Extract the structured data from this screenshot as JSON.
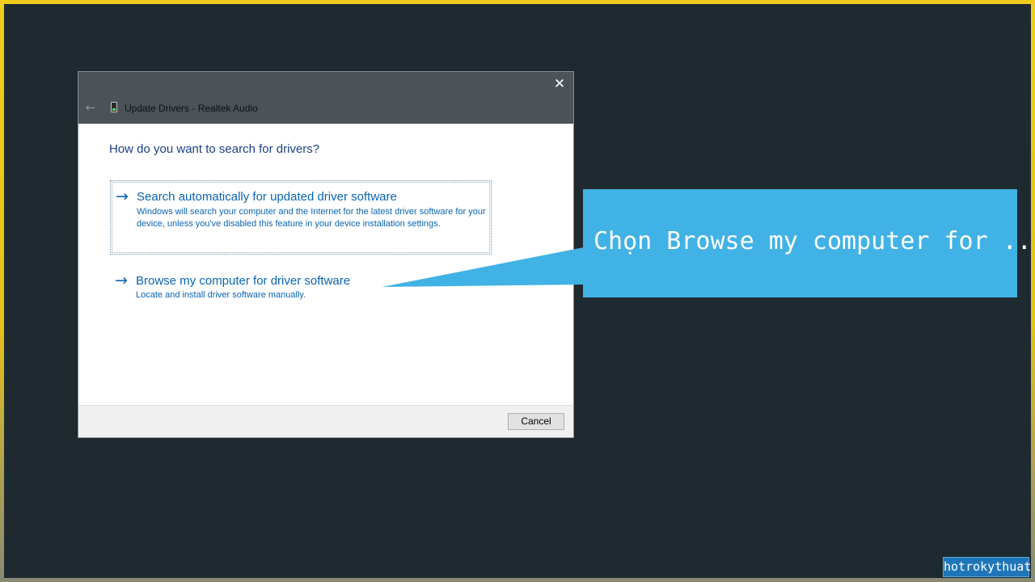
{
  "dialog": {
    "title": "Update Drivers - Realtek Audio",
    "close_icon": "close-icon",
    "back_icon": "back-arrow-icon",
    "device_icon": "audio-device-icon",
    "heading": "How do you want to search for drivers?",
    "options": [
      {
        "title": "Search automatically for updated driver software",
        "description": "Windows will search your computer and the Internet for the latest driver software for your device, unless you've disabled this feature in your device installation settings.",
        "icon": "arrow-right-icon"
      },
      {
        "title": "Browse my computer for driver software",
        "description": "Locate and install driver software manually.",
        "icon": "arrow-right-icon"
      }
    ],
    "cancel_label": "Cancel"
  },
  "callout": {
    "text": "Chọn Browse my computer for ..."
  },
  "watermark": "hotrokythuat",
  "colors": {
    "background": "#1f2a30",
    "frame": "#f2cc1c",
    "titlebar": "#4b5358",
    "link": "#0a64b4",
    "heading": "#1a3f85",
    "callout": "#41b2e5"
  }
}
